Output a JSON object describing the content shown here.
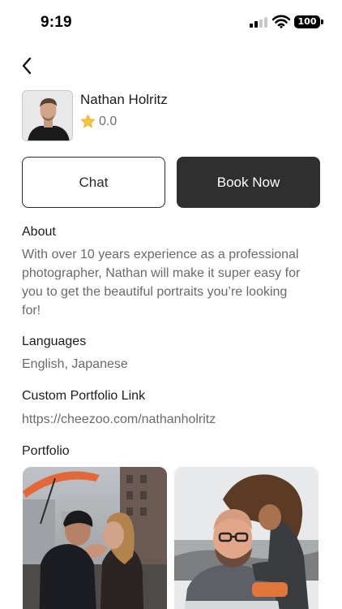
{
  "status_bar": {
    "time": "9:19",
    "battery": "100",
    "icons": [
      "signal-icon",
      "wifi-icon",
      "battery-icon"
    ]
  },
  "nav": {
    "back_icon": "chevron-left-icon"
  },
  "profile": {
    "name": "Nathan Holritz",
    "rating": "0.0",
    "rating_icon": "star-icon",
    "star_color": "#f4c43a"
  },
  "actions": {
    "chat_label": "Chat",
    "book_label": "Book Now",
    "book_color": "#2f2f2f"
  },
  "about": {
    "title": "About",
    "lines": [
      "With over 10 years experience as a professional",
      "photographer, Nathan will make it super easy for",
      "you to get the beautiful portraits you’re looking",
      "for!"
    ]
  },
  "languages": {
    "title": "Languages",
    "value": "English, Japanese"
  },
  "portfolio_link": {
    "title": "Custom Portfolio Link",
    "value": "https://cheezoo.com/nathanholritz"
  },
  "portfolio": {
    "title": "Portfolio",
    "photos": [
      "portfolio-photo-couple-umbrella",
      "portfolio-photo-couple-hug"
    ]
  }
}
